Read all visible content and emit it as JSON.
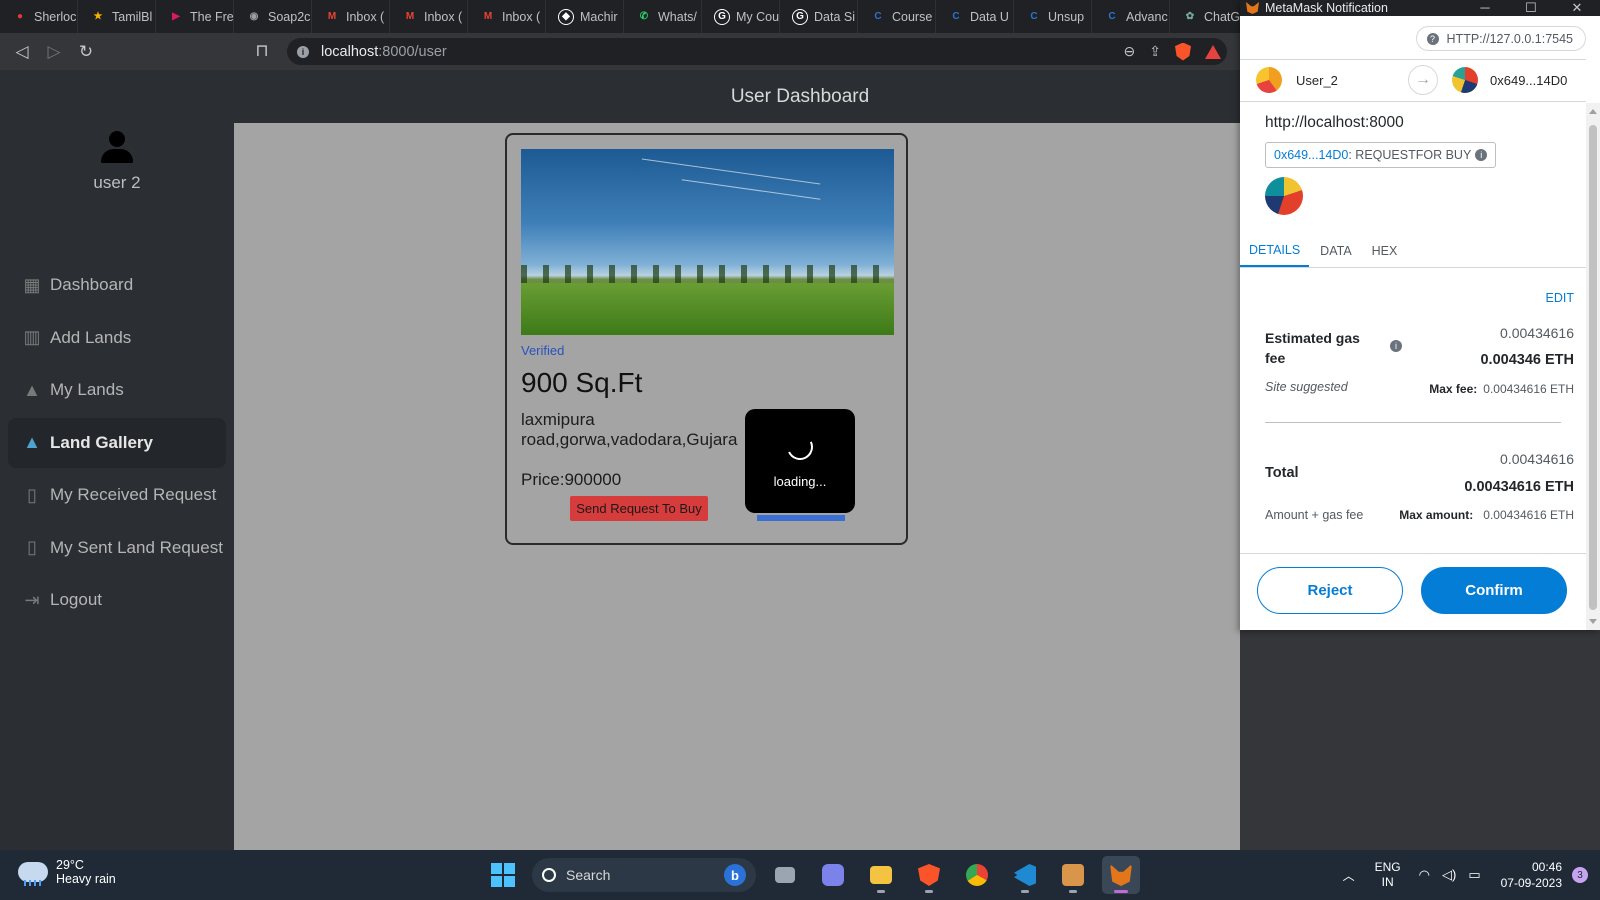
{
  "browser": {
    "tabs": [
      {
        "label": "Sherloc",
        "color": "#e53935",
        "glyph": "●"
      },
      {
        "label": "TamilBl",
        "color": "#f4b400",
        "glyph": "★"
      },
      {
        "label": "The Fre",
        "color": "#d81b60",
        "glyph": "▶"
      },
      {
        "label": "Soap2c",
        "color": "#9e9e9e",
        "glyph": "◉"
      },
      {
        "label": "Inbox (",
        "color": "#ea4335",
        "glyph": "M"
      },
      {
        "label": "Inbox (",
        "color": "#ea4335",
        "glyph": "M"
      },
      {
        "label": "Inbox (",
        "color": "#ea4335",
        "glyph": "M"
      },
      {
        "label": "Machir",
        "color": "#ffffff",
        "glyph": "◆"
      },
      {
        "label": "Whats/",
        "color": "#25d366",
        "glyph": "✆"
      },
      {
        "label": "My Cou",
        "color": "#ffffff",
        "glyph": "G"
      },
      {
        "label": "Data Si",
        "color": "#ffffff",
        "glyph": "G"
      },
      {
        "label": "Course",
        "color": "#2a73cc",
        "glyph": "C"
      },
      {
        "label": "Data U",
        "color": "#2a73cc",
        "glyph": "C"
      },
      {
        "label": "Unsup",
        "color": "#2a73cc",
        "glyph": "C"
      },
      {
        "label": "Advanc",
        "color": "#2a73cc",
        "glyph": "C"
      },
      {
        "label": "ChatGP",
        "color": "#74aa9c",
        "glyph": "✿"
      }
    ],
    "url_host": "localhost",
    "url_path": ":8000/user"
  },
  "app": {
    "header_title": "User Dashboard",
    "username": "user 2",
    "menu": [
      {
        "label": "Dashboard",
        "icon": "dashboard-icon",
        "glyph": "▦",
        "active": false
      },
      {
        "label": "Add Lands",
        "icon": "add-chart-icon",
        "glyph": "▥",
        "active": false
      },
      {
        "label": "My Lands",
        "icon": "landscape-icon",
        "glyph": "▲",
        "active": false
      },
      {
        "label": "Land Gallery",
        "icon": "landscape-icon",
        "glyph": "▲",
        "active": true
      },
      {
        "label": "My Received Request",
        "icon": "receipt-icon",
        "glyph": "▯",
        "active": false
      },
      {
        "label": "My Sent Land Request",
        "icon": "receipt-icon",
        "glyph": "▯",
        "active": false
      },
      {
        "label": "Logout",
        "icon": "logout-icon",
        "glyph": "⇥",
        "active": false
      }
    ],
    "card": {
      "status": "Verified",
      "area": "900 Sq.Ft",
      "address_line1": "laxmipura",
      "address_line2": "road,gorwa,vadodara,Gujara",
      "price": "Price:900000",
      "buy_button": "Send Request To Buy"
    },
    "loading_text": "loading..."
  },
  "metamask": {
    "window_title": "MetaMask Notification",
    "network": "HTTP://127.0.0.1:7545",
    "from_account": "User_2",
    "to_account": "0x649...14D0",
    "origin": "http://localhost:8000",
    "method_address": "0x649...14D0",
    "method_name": " : REQUESTFOR BUY",
    "tabs": [
      "DETAILS",
      "DATA",
      "HEX"
    ],
    "edit_label": "EDIT",
    "gas_label": "Estimated gas fee",
    "gas_sub": "0.00434616",
    "gas_main": "0.004346 ETH",
    "site_suggested": "Site suggested",
    "max_fee_label": "Max fee:",
    "max_fee_value": "0.00434616 ETH",
    "total_label": "Total",
    "total_sub": "0.00434616",
    "total_main": "0.00434616 ETH",
    "amount_gas": "Amount + gas fee",
    "max_amount_label": "Max amount:",
    "max_amount_value": "0.00434616 ETH",
    "reject_label": "Reject",
    "confirm_label": "Confirm"
  },
  "taskbar": {
    "temperature": "29°C",
    "weather": "Heavy rain",
    "search_label": "Search",
    "lang_top": "ENG",
    "lang_bottom": "IN",
    "time": "00:46",
    "date": "07-09-2023",
    "notification_count": "3"
  }
}
